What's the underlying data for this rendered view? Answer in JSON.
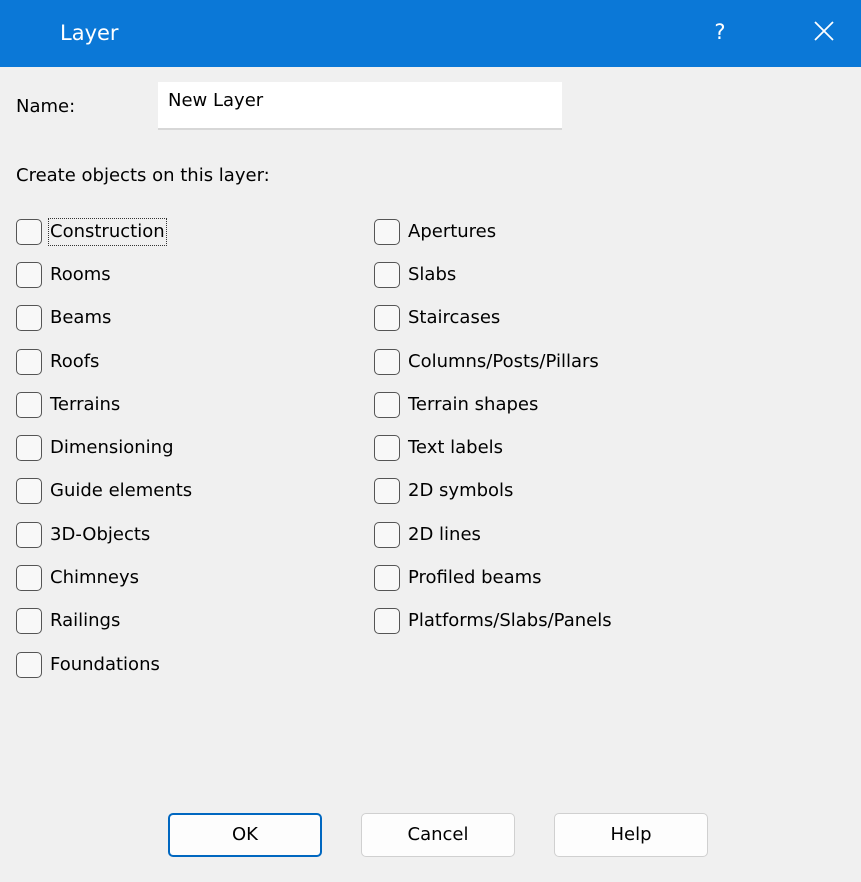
{
  "window": {
    "title": "Layer",
    "help_glyph": "?",
    "close_icon": "close-icon",
    "title_bar_color": "#0b78d7"
  },
  "name_field": {
    "label": "Name:",
    "value": "New Layer"
  },
  "create_label": "Create objects on this layer:",
  "left_items": [
    {
      "label": "Construction",
      "checked": false
    },
    {
      "label": "Rooms",
      "checked": false
    },
    {
      "label": "Beams",
      "checked": false
    },
    {
      "label": "Roofs",
      "checked": false
    },
    {
      "label": "Terrains",
      "checked": false
    },
    {
      "label": "Dimensioning",
      "checked": false
    },
    {
      "label": "Guide elements",
      "checked": false
    },
    {
      "label": "3D-Objects",
      "checked": false
    },
    {
      "label": "Chimneys",
      "checked": false
    },
    {
      "label": "Railings",
      "checked": false
    },
    {
      "label": "Foundations",
      "checked": false
    }
  ],
  "right_items": [
    {
      "label": "Apertures",
      "checked": false
    },
    {
      "label": "Slabs",
      "checked": false
    },
    {
      "label": "Staircases",
      "checked": false
    },
    {
      "label": "Columns/Posts/Pillars",
      "checked": false
    },
    {
      "label": "Terrain shapes",
      "checked": false
    },
    {
      "label": "Text labels",
      "checked": false
    },
    {
      "label": "2D symbols",
      "checked": false
    },
    {
      "label": "2D lines",
      "checked": false
    },
    {
      "label": "Profiled beams",
      "checked": false
    },
    {
      "label": "Platforms/Slabs/Panels",
      "checked": false
    }
  ],
  "buttons": {
    "ok": "OK",
    "cancel": "Cancel",
    "help": "Help"
  }
}
